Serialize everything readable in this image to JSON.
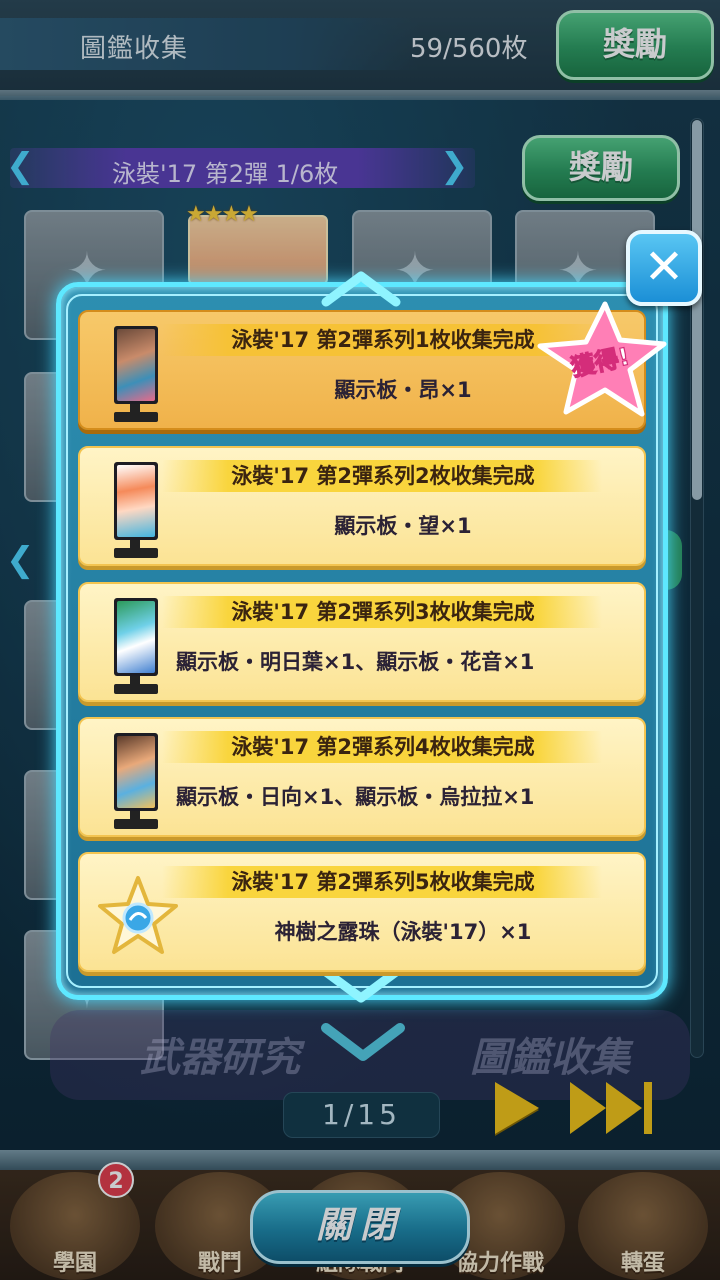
{
  "header": {
    "title": "圖鑑收集",
    "count": "59/560枚",
    "reward_label": "獎勵"
  },
  "series": {
    "label": "泳裝'17 第2彈 1/6枚",
    "reward_label": "獎勵",
    "card_stars": "★★★★"
  },
  "modal": {
    "close_icon": "close-icon",
    "obtained_label": "獲得!",
    "items": [
      {
        "title": "泳裝'17 第2彈系列1枚收集完成",
        "content": "顯示板・昂×1",
        "status": "obtained"
      },
      {
        "title": "泳裝'17 第2彈系列2枚收集完成",
        "content": "顯示板・望×1",
        "status": "pending"
      },
      {
        "title": "泳裝'17 第2彈系列3枚收集完成",
        "content": "顯示板・明日葉×1、顯示板・花音×1",
        "status": "pending"
      },
      {
        "title": "泳裝'17 第2彈系列4枚收集完成",
        "content": "顯示板・日向×1、顯示板・烏拉拉×1",
        "status": "pending"
      },
      {
        "title": "泳裝'17 第2彈系列5枚收集完成",
        "content": "神樹之露珠（泳裝'17）×1",
        "status": "pending"
      }
    ]
  },
  "background_buttons": {
    "weapon": "武器研究",
    "collection": "圖鑑收集"
  },
  "pager": {
    "text": "1/15"
  },
  "tabs": [
    {
      "label": "學園",
      "badge": "2"
    },
    {
      "label": "戰鬥"
    },
    {
      "label": "組隊戰鬥"
    },
    {
      "label": "協力作戰"
    },
    {
      "label": "轉蛋"
    }
  ],
  "close_button": {
    "label": "關閉"
  },
  "colors": {
    "accent_cyan": "#5ee8ff",
    "reward_green": "#2c9a60",
    "item_yellow": "#fbe394",
    "item_done": "#f0b24a",
    "obtained_pink": "#ff5fa8"
  }
}
